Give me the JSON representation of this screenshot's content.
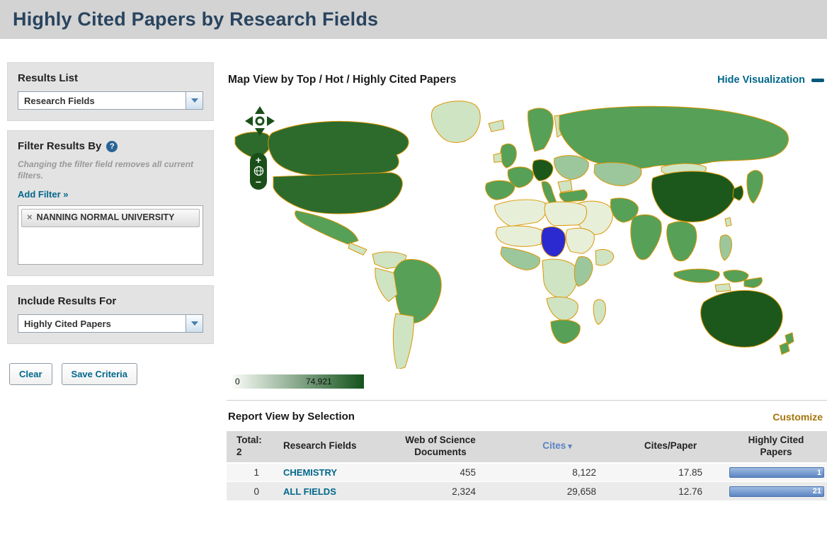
{
  "page": {
    "title": "Highly Cited Papers by Research Fields"
  },
  "sidebar": {
    "results_list": {
      "label": "Results List",
      "selected": "Research Fields"
    },
    "filter": {
      "label": "Filter Results By",
      "help_icon": "?",
      "note": "Changing the filter field removes all current filters.",
      "add_filter_label": "Add Filter »",
      "tags": [
        {
          "remove_icon": "×",
          "label": "NANNING NORMAL UNIVERSITY"
        }
      ]
    },
    "include": {
      "label": "Include Results For",
      "selected": "Highly Cited Papers"
    },
    "buttons": {
      "clear": "Clear",
      "save": "Save Criteria"
    }
  },
  "map": {
    "title": "Map View by Top / Hot / Highly Cited Papers",
    "hide_link": "Hide Visualization",
    "controls": {
      "zoom_in": "+",
      "zoom_out": "−"
    },
    "legend": {
      "min": "0",
      "max": "74,921",
      "color_low": "#fafcf8",
      "color_high": "#14531c"
    },
    "colors": {
      "country_border": "#dd9400",
      "highlight_country": "#2a2ad0"
    }
  },
  "report": {
    "title": "Report View by Selection",
    "customize_label": "Customize",
    "table": {
      "total_label": "Total:",
      "total_value": "2",
      "columns": [
        "Research Fields",
        "Web of Science Documents",
        "Cites",
        "Cites/Paper",
        "Highly Cited Papers"
      ],
      "sort_caret": "▾",
      "rows": [
        {
          "index": "1",
          "field": "CHEMISTRY",
          "web_of_science_documents": "455",
          "cites": "8,122",
          "cites_per_paper": "17.85",
          "highly_cited_papers": "1"
        },
        {
          "index": "0",
          "field": "ALL FIELDS",
          "web_of_science_documents": "2,324",
          "cites": "29,658",
          "cites_per_paper": "12.76",
          "highly_cited_papers": "21"
        }
      ]
    }
  }
}
